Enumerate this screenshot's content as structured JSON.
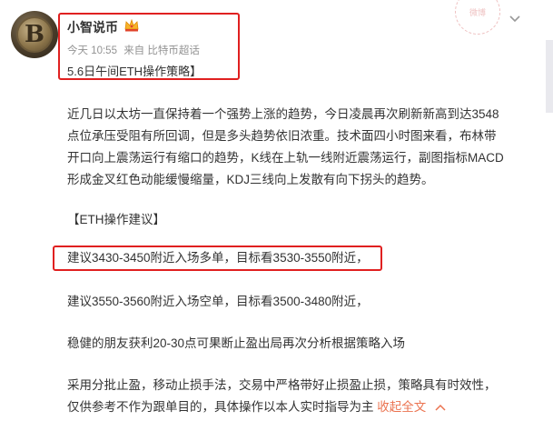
{
  "post": {
    "username": "小智说币",
    "meta": {
      "time": "今天 10:55",
      "source": "来自 比特币超话"
    },
    "subtitle": "5.6日午间ETH操作策略】",
    "stamp_text": "微博"
  },
  "content": {
    "paragraph1": [
      "近几日以太坊一直保持着一个强势上涨的趋势，今日凌晨再次刷新新高到达3548",
      "点位承压受阻有所回调，但是多头趋势依旧浓重。技术面四小时图来看，布林带",
      "开口向上震荡运行有缩口的趋势，K线在上轨一线附近震荡运行，副图指标MACD",
      "形成金叉红色动能缓慢缩量，KDJ三线向上发散有向下拐头的趋势。"
    ],
    "advice_heading": "【ETH操作建议】",
    "advice_long": "建议3430-3450附近入场多单，目标看3530-3550附近，",
    "advice_short": "建议3550-3560附近入场空单，目标看3500-3480附近，",
    "advice_friends": "稳健的朋友获利20-30点可果断止盈出局再次分析根据策略入场",
    "closing": [
      "采用分批止盈，移动止损手法，交易中严格带好止损盈止损，策略具有时效性，",
      "仅供参考不作为跟单目的，具体操作以本人实时指导为主"
    ],
    "expand_label": "收起全文"
  },
  "icons": {
    "crown": "crown-icon",
    "chevron": "chevron-down-icon",
    "collapse": "chevron-up-icon"
  },
  "colors": {
    "highlight_box": "#e02020",
    "link": "#eb7350",
    "meta_text": "#939393"
  }
}
